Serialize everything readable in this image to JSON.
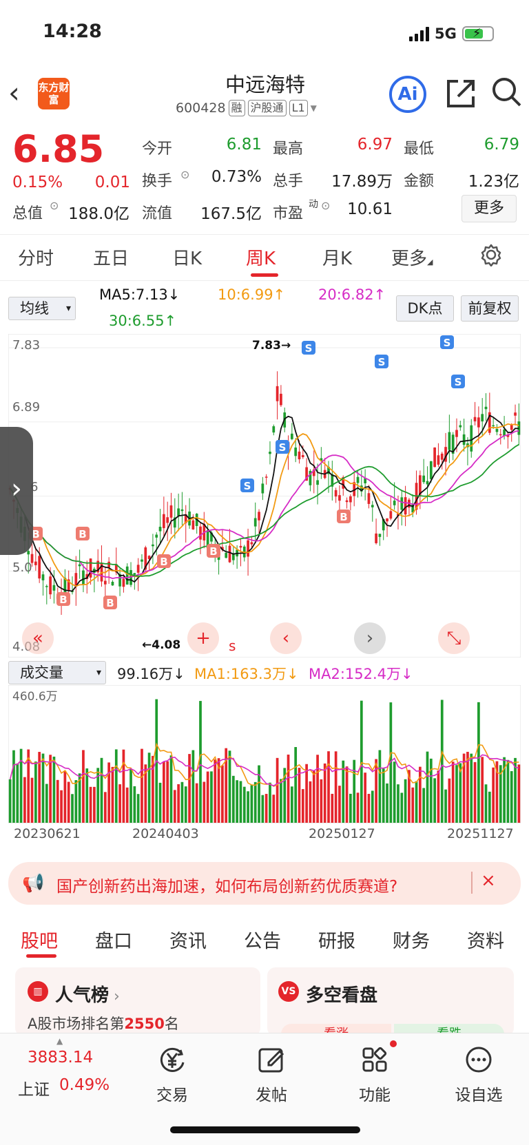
{
  "status": {
    "time": "14:28",
    "network": "5G"
  },
  "header": {
    "logo_text": "东方财富",
    "name": "中远海特",
    "code": "600428",
    "tags": [
      "融",
      "沪股通",
      "L1"
    ],
    "ai_label": "Ai"
  },
  "quote": {
    "price": "6.85",
    "change_pct": "0.15%",
    "change_abs": "0.01",
    "open_label": "今开",
    "open": "6.81",
    "high_label": "最高",
    "high": "6.97",
    "low_label": "最低",
    "low": "6.79",
    "turnover_label": "换手",
    "turnover": "0.73%",
    "volume_label": "总手",
    "volume": "17.89万",
    "amount_label": "金额",
    "amount": "1.23亿",
    "mktcap_label": "总值",
    "mktcap": "188.0亿",
    "float_label": "流值",
    "float_cap": "167.5亿",
    "pe_label": "市盈",
    "pe_sup": "动",
    "pe": "10.61",
    "more_label": "更多"
  },
  "chart_tabs": [
    "分时",
    "五日",
    "日K",
    "周K",
    "月K",
    "更多"
  ],
  "ma_bar": {
    "select": "均线",
    "ma5": "MA5:7.13↓",
    "ma10": "10:6.99↑",
    "ma20": "20:6.82↑",
    "ma30": "30:6.55↑",
    "dk": "DK点",
    "adjust": "前复权"
  },
  "kline": {
    "y_top": "7.83",
    "y_mid": "6.89",
    "y_low": "5.0",
    "y_bottom": "4.08",
    "y_mark": "6",
    "max_marker": "7.83→",
    "min_marker": "←4.08",
    "ma_colors": {
      "ma5": "#111111",
      "ma10": "#f29a12",
      "ma20": "#d62cc6",
      "ma30": "#1e9c2e"
    }
  },
  "volume_bar": {
    "select": "成交量",
    "vol": "99.16万↓",
    "ma1": "MA1:163.3万↓",
    "ma2": "MA2:152.4万↓",
    "y_top": "460.6万",
    "dates": [
      "20230621",
      "20240403",
      "20250127",
      "20251127"
    ]
  },
  "banner": {
    "text": "国产创新药出海加速，如何布局创新药优质赛道?"
  },
  "info_tabs": [
    "股吧",
    "盘口",
    "资讯",
    "公告",
    "研报",
    "财务",
    "资料"
  ],
  "cards": {
    "popularity_title": "人气榜",
    "popularity_sub_prefix": "A股市场排名第",
    "popularity_rank": "2550",
    "popularity_sub_suffix": "名",
    "longshort_title": "多空看盘",
    "rise_label": "看涨",
    "fall_label": "看跌"
  },
  "bottom": {
    "index_value": "3883.14",
    "index_name": "上证",
    "index_change": "0.49%",
    "trade": "交易",
    "post": "发帖",
    "func": "功能",
    "watch": "设自选"
  }
}
